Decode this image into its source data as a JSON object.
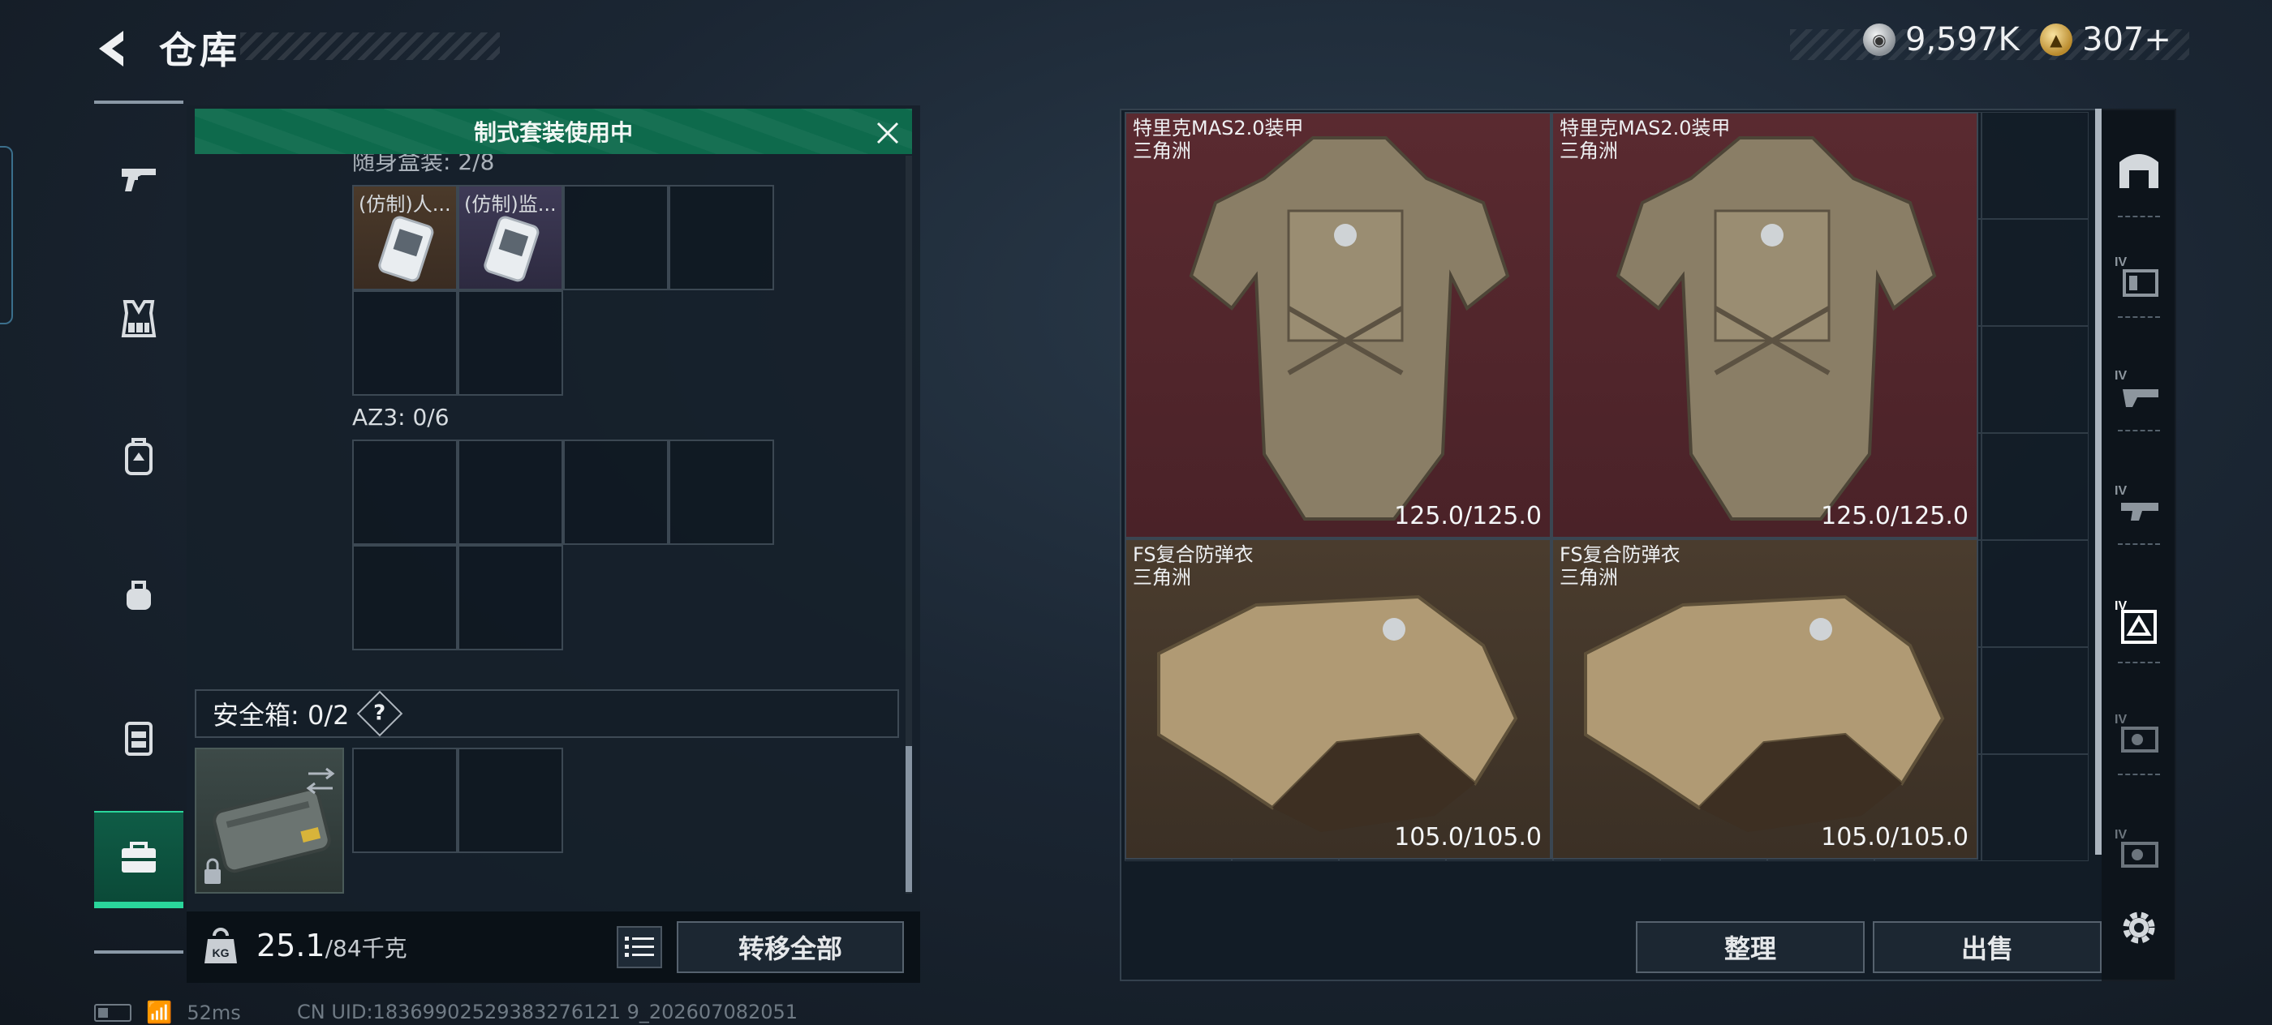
{
  "header": {
    "title": "仓库",
    "currency": [
      {
        "icon": "silver-coin-icon",
        "value": "9,597K"
      },
      {
        "icon": "gold-coin-icon",
        "value": "307+"
      }
    ]
  },
  "left_nav": {
    "items": [
      {
        "name": "weapons",
        "icon": "pistol-icon"
      },
      {
        "name": "chest-rig",
        "icon": "chest-rig-icon"
      },
      {
        "name": "backpack",
        "icon": "backpack-icon"
      },
      {
        "name": "helmet",
        "icon": "helmet-bag-icon"
      },
      {
        "name": "armor",
        "icon": "armor-icon"
      },
      {
        "name": "toolbox",
        "icon": "toolbox-icon",
        "active": true
      }
    ]
  },
  "container": {
    "banner": "制式套装使用中",
    "partial_label": "随身盒装: 2/8",
    "items": [
      {
        "name": "(仿制)人..."
      },
      {
        "name": "(仿制)监..."
      }
    ],
    "az3_label": "AZ3: 0/6",
    "safe_box_label": "安全箱: 0/2",
    "safe_box_help": "?",
    "weight_current": "25.1",
    "weight_max": "/84千克",
    "transfer_all": "转移全部"
  },
  "storage": {
    "items": [
      {
        "name": "特里克MAS2.0装甲",
        "sub": "三角洲",
        "durability": "125.0/125.0",
        "rarity": "red"
      },
      {
        "name": "特里克MAS2.0装甲",
        "sub": "三角洲",
        "durability": "125.0/125.0",
        "rarity": "red"
      },
      {
        "name": "FS复合防弹衣",
        "sub": "三角洲",
        "durability": "105.0/105.0",
        "rarity": "tan"
      },
      {
        "name": "FS复合防弹衣",
        "sub": "三角洲",
        "durability": "105.0/105.0",
        "rarity": "tan"
      }
    ],
    "sort": "整理",
    "sell": "出售"
  },
  "right_nav": {
    "items": [
      {
        "icon": "home-base-icon"
      },
      {
        "icon": "storage-iv-1-icon",
        "tag": "IV"
      },
      {
        "icon": "storage-iv-2-icon",
        "tag": "IV"
      },
      {
        "icon": "storage-iv-3-icon",
        "tag": "IV"
      },
      {
        "icon": "storage-iv-4-icon",
        "tag": "IV",
        "active": true
      },
      {
        "icon": "storage-iv-5-icon",
        "tag": "IV"
      },
      {
        "icon": "storage-iv-6-icon",
        "tag": "IV"
      },
      {
        "icon": "settings-icon"
      }
    ]
  },
  "status": {
    "ping": "52ms",
    "uid": "CN UID:18369902529383276121 9_202607082051"
  },
  "colors": {
    "accent": "#2ad69b",
    "banner": "#0e6a4c",
    "red_rarity": "#5a2a30",
    "tan_rarity": "#4a3c2e"
  }
}
